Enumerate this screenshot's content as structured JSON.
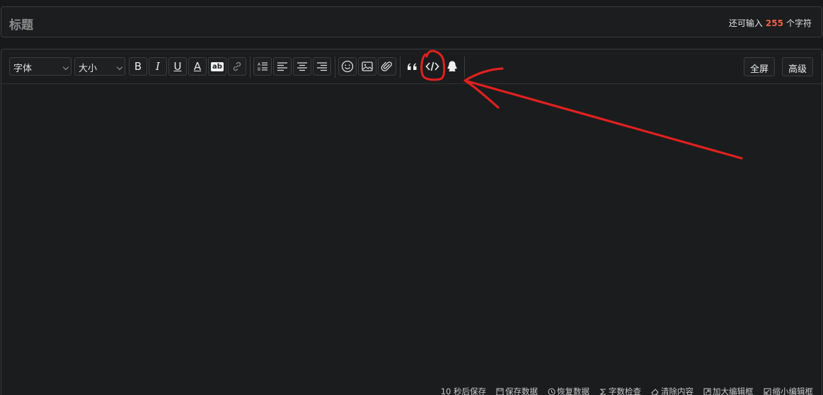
{
  "title_field": {
    "placeholder": "标题",
    "counter_prefix": "还可输入",
    "counter_value": "255",
    "counter_suffix": "个字符"
  },
  "toolbar": {
    "font_select": "字体",
    "size_select": "大小",
    "bold": "B",
    "italic": "I",
    "underline": "U",
    "font_color": "A",
    "bg_color": "ab",
    "fullscreen": "全屏",
    "advanced": "高级"
  },
  "status_bar": {
    "autosave": "10 秒后保存",
    "save_data": "保存数据",
    "restore_data": "恢复数据",
    "word_check": "字数检查",
    "clear_content": "清除内容",
    "enlarge_editor": "加大编辑框",
    "shrink_editor": "缩小编辑框"
  },
  "colors": {
    "background": "#18191b",
    "accent_count": "#f06044",
    "annotation_red": "#e0211e"
  },
  "icons": [
    "link-icon",
    "ordered-list-icon",
    "align-left-icon",
    "align-center-icon",
    "align-right-icon",
    "emoji-icon",
    "image-icon",
    "attachment-icon",
    "quote-icon",
    "code-icon",
    "qq-icon"
  ]
}
